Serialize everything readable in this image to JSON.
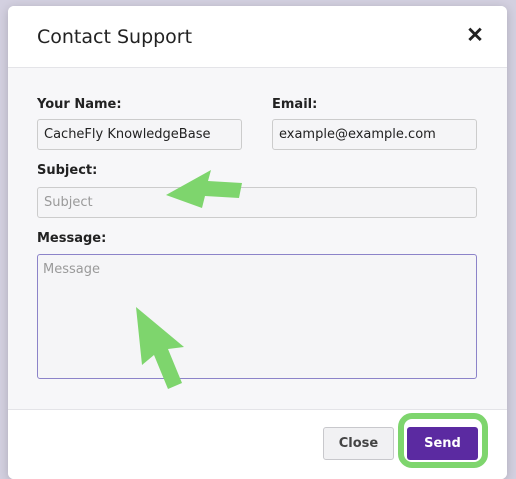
{
  "dialog": {
    "title": "Contact Support",
    "close_icon": "close-icon"
  },
  "form": {
    "name_label": "Your Name:",
    "name_value": "CacheFly KnowledgeBase",
    "email_label": "Email:",
    "email_value": "example@example.com",
    "subject_label": "Subject:",
    "subject_placeholder": "Subject",
    "message_label": "Message:",
    "message_placeholder": "Message"
  },
  "footer": {
    "close_label": "Close",
    "send_label": "Send"
  },
  "colors": {
    "accent": "#5b2aa1",
    "annotation": "#7ed56d"
  },
  "annotations": {
    "arrow_icon": "arrow-icon",
    "highlight": "send-button-highlight"
  }
}
